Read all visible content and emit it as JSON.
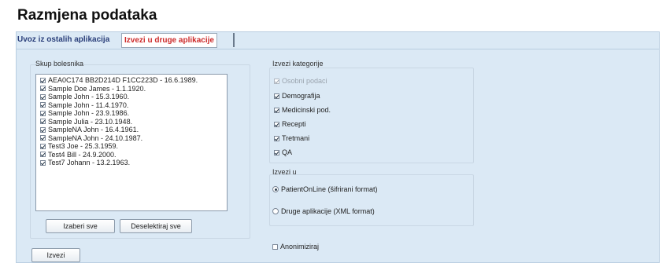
{
  "page": {
    "title": "Razmjena podataka"
  },
  "tabs": [
    {
      "label": "Uvoz iz ostalih aplikacija",
      "active": false
    },
    {
      "label": "Izvezi u druge aplikacije",
      "active": true
    }
  ],
  "patients": {
    "legend": "Skup bolesnika",
    "items": [
      {
        "label": "AEA0C174 BB2D214D F1CC223D - 16.6.1989.",
        "checked": true
      },
      {
        "label": "Sample Doe James - 1.1.1920.",
        "checked": true
      },
      {
        "label": "Sample John - 15.3.1960.",
        "checked": true
      },
      {
        "label": "Sample John - 11.4.1970.",
        "checked": true
      },
      {
        "label": "Sample John - 23.9.1986.",
        "checked": true
      },
      {
        "label": "Sample Julia - 23.10.1948.",
        "checked": true
      },
      {
        "label": "SampleNA John - 16.4.1961.",
        "checked": true
      },
      {
        "label": "SampleNA John - 24.10.1987.",
        "checked": true
      },
      {
        "label": "Test3 Joe - 25.3.1959.",
        "checked": true
      },
      {
        "label": "Test4 Bill - 24.9.2000.",
        "checked": true
      },
      {
        "label": "Test7 Johann - 13.2.1963.",
        "checked": true
      }
    ],
    "select_all": "Izaberi sve",
    "deselect_all": "Deselektiraj sve"
  },
  "categories": {
    "legend": "Izvezi kategorije",
    "items": [
      {
        "label": "Osobni podaci",
        "checked": true,
        "disabled": true
      },
      {
        "label": "Demografija",
        "checked": true,
        "disabled": false
      },
      {
        "label": "Medicinski pod.",
        "checked": true,
        "disabled": false
      },
      {
        "label": "Recepti",
        "checked": true,
        "disabled": false
      },
      {
        "label": "Tretmani",
        "checked": true,
        "disabled": false
      },
      {
        "label": "QA",
        "checked": true,
        "disabled": false
      }
    ]
  },
  "export_to": {
    "legend": "Izvezi u",
    "options": [
      {
        "label": "PatientOnLine (šifrirani format)",
        "selected": true
      },
      {
        "label": "Druge aplikacije (XML format)",
        "selected": false
      }
    ]
  },
  "anonymize": {
    "label": "Anonimiziraj",
    "checked": false
  },
  "export_button": "Izvezi"
}
